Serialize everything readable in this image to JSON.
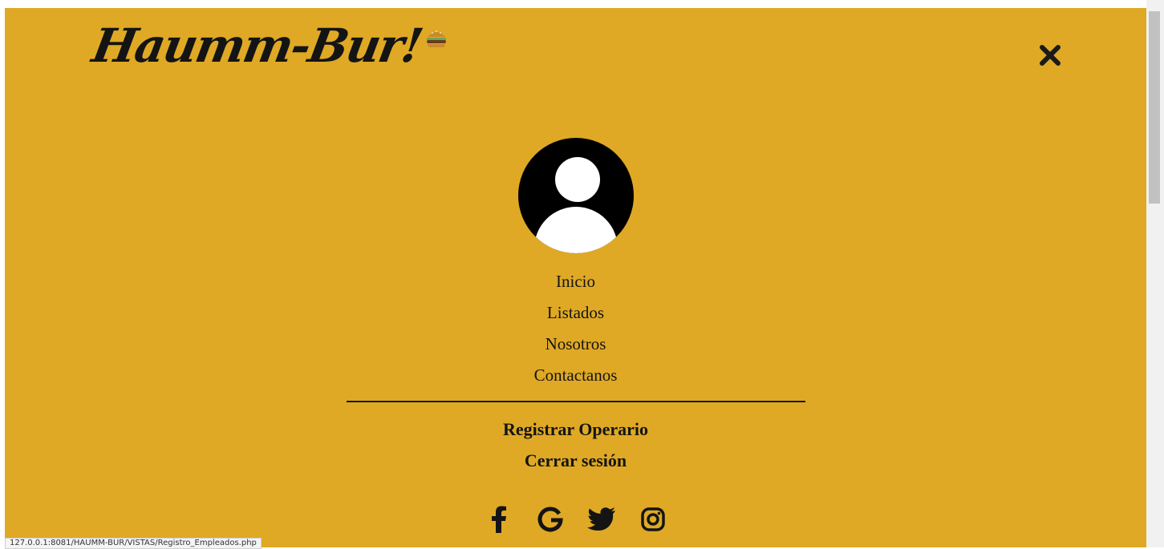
{
  "brand": {
    "name": "Haumm-Bur!",
    "emoji_icon": "burger-icon"
  },
  "header": {
    "close_icon": "close-icon"
  },
  "menu": {
    "avatar_icon": "user-avatar-icon",
    "nav_items": [
      {
        "label": "Inicio"
      },
      {
        "label": "Listados"
      },
      {
        "label": "Nosotros"
      },
      {
        "label": "Contactanos"
      }
    ],
    "actions": [
      {
        "label": "Registrar Operario"
      },
      {
        "label": "Cerrar sesión"
      }
    ]
  },
  "social": [
    {
      "icon": "facebook-icon"
    },
    {
      "icon": "google-icon"
    },
    {
      "icon": "twitter-icon"
    },
    {
      "icon": "instagram-icon"
    }
  ],
  "status_bar": {
    "url": "127.0.0.1:8081/HAUMM-BUR/VISTAS/Registro_Empleados.php"
  },
  "colors": {
    "background": "#dfa925",
    "text": "#141414"
  }
}
